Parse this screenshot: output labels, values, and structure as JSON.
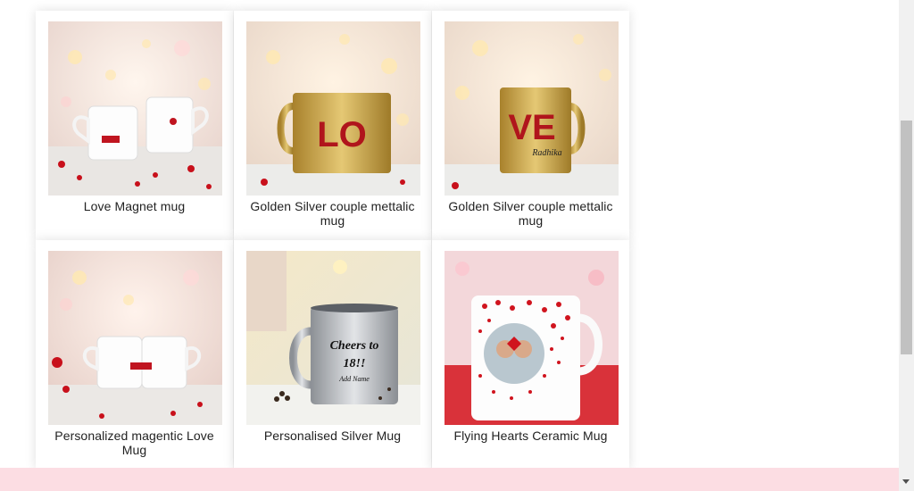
{
  "products": [
    {
      "title": "Love Magnet mug",
      "image_icon": "love-magnet-mug-image"
    },
    {
      "title": "Golden Silver couple mettalic mug",
      "image_icon": "golden-mug-lo-image"
    },
    {
      "title": "Golden Silver couple mettalic mug",
      "image_icon": "golden-mug-ve-image"
    },
    {
      "title": "Personalized magentic Love Mug",
      "image_icon": "magnetic-love-mugs-image"
    },
    {
      "title": "Personalised Silver Mug",
      "image_icon": "silver-mug-image"
    },
    {
      "title": "Flying Hearts Ceramic Mug",
      "image_icon": "flying-hearts-mug-image"
    }
  ],
  "mug_text": {
    "lo": "LO",
    "ve": "VE",
    "ve_name": "Radhika",
    "silver_line1": "Cheers to",
    "silver_line2": "18!!",
    "silver_line3": "Add Name"
  },
  "footer": {
    "background": "#fcdde3"
  },
  "colors": {
    "heart_red": "#d0141e",
    "gold": "#c8a24a",
    "silver": "#b9bcc0",
    "card_bg": "#ffffff"
  }
}
